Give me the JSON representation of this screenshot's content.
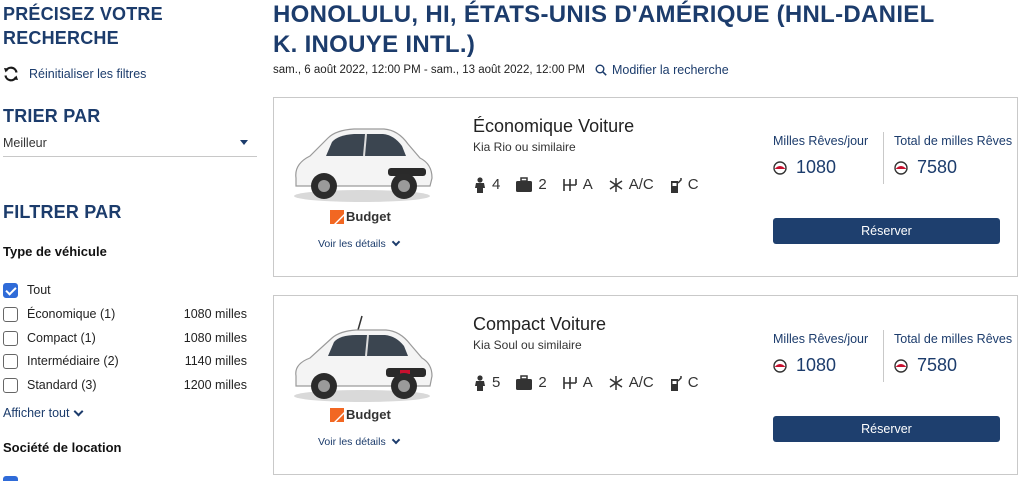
{
  "sidebar": {
    "refine_title_line1": "PRÉCISEZ VOTRE",
    "refine_title_line2": "RECHERCHE",
    "reset_label": "Réinitialiser les filtres",
    "sort_title": "TRIER PAR",
    "sort_value": "Meilleur",
    "filter_title": "FILTRER PAR",
    "vehicle_type_title": "Type de véhicule",
    "vehicle_types": [
      {
        "label": "Tout",
        "miles": "",
        "checked": true
      },
      {
        "label": "Économique  (1)",
        "miles": "1080 milles",
        "checked": false
      },
      {
        "label": "Compact  (1)",
        "miles": "1080 milles",
        "checked": false
      },
      {
        "label": "Intermédiaire  (2)",
        "miles": "1140 milles",
        "checked": false
      },
      {
        "label": "Standard  (3)",
        "miles": "1200 milles",
        "checked": false
      }
    ],
    "show_all_label": "Afficher tout",
    "rental_company_title": "Société de location"
  },
  "main": {
    "title_line1": "HONOLULU, HI, ÉTATS-UNIS D'AMÉRIQUE (HNL-DANIEL",
    "title_line2": "K. INOUYE INTL.)",
    "dates": "sam., 6 août 2022, 12:00 PM - sam., 13 août 2022, 12:00 PM",
    "modify_label": "Modifier la recherche"
  },
  "cars": [
    {
      "category": "Économique Voiture",
      "model": "Kia Rio ou similaire",
      "passengers": "4",
      "bags": "2",
      "transmission": "A",
      "ac": "A/C",
      "fuel": "C",
      "brand": "Budget",
      "details_label": "Voir les détails",
      "per_day_label": "Milles Rêves/jour",
      "per_day_value": "1080",
      "total_label": "Total de milles Rêves",
      "total_value": "7580",
      "reserve_label": "Réserver"
    },
    {
      "category": "Compact Voiture",
      "model": "Kia Soul ou similaire",
      "passengers": "5",
      "bags": "2",
      "transmission": "A",
      "ac": "A/C",
      "fuel": "C",
      "brand": "Budget",
      "details_label": "Voir les détails",
      "per_day_label": "Milles Rêves/jour",
      "per_day_value": "1080",
      "total_label": "Total de milles Rêves",
      "total_value": "7580",
      "reserve_label": "Réserver"
    }
  ],
  "colors": {
    "brand_navy": "#1c3c6c",
    "button_navy": "#1e3f6e",
    "checkbox_blue": "#2f6bd8",
    "budget_orange": "#f26722"
  },
  "icons": {
    "reset": "refresh-icon",
    "search": "magnifier-icon",
    "passengers": "person-icon",
    "bags": "suitcase-icon",
    "transmission": "gear-shift-icon",
    "ac": "snowflake-icon",
    "fuel": "fuel-pump-icon",
    "miles": "dream-miles-icon"
  }
}
